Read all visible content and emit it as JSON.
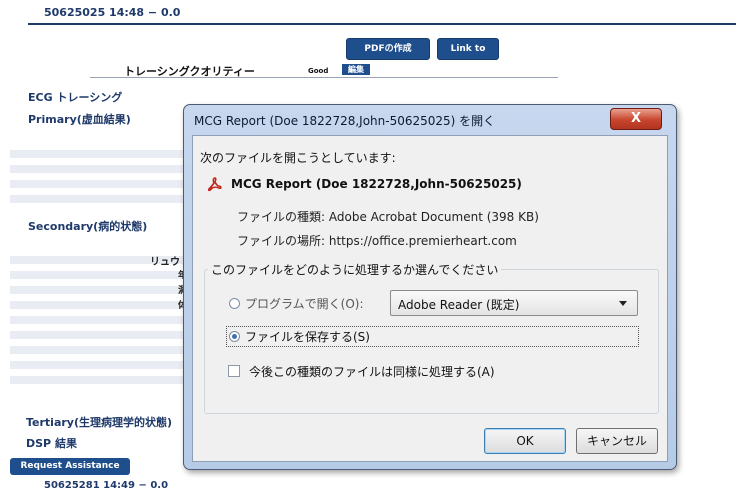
{
  "background": {
    "header_line": "50625025 14:48 − 0.0",
    "pdf_button": "PDFの作成",
    "link_button": "Link to",
    "tracing_quality_label": "トレーシングクオリティー",
    "tracing_quality_value": "Good",
    "edit_button": "編集",
    "ecg_label": "ECG トレーシング",
    "primary_label": "Primary(虚血結果)",
    "secondary_label": "Secondary(病的状態)",
    "row_label": "リュウ",
    "row_chars": [
      "年",
      "洞",
      "体"
    ],
    "tertiary_label": "Tertiary(生理病理学的状態)",
    "dsp_label": "DSP 結果",
    "request_button": "Request Assistance",
    "footer_line": "50625281 14:49 − 0.0"
  },
  "dialog": {
    "title": "MCG Report (Doe 1822728,John-50625025) を開く",
    "close_label": "X",
    "intro": "次のファイルを開こうとしています:",
    "file_icon": "pdf-icon",
    "file_name": "MCG Report (Doe 1822728,John-50625025)",
    "file_type_label": "ファイルの種類:",
    "file_type_value": "Adobe Acrobat Document (398 KB)",
    "file_location_label": "ファイルの場所:",
    "file_location_value": "https://office.premierheart.com",
    "group_label": "このファイルをどのように処理するか選んでください",
    "open_with_label": "プログラムで開く(O):",
    "open_with_app": "Adobe Reader (既定)",
    "save_label": "ファイルを保存する(S)",
    "save_selected": true,
    "remember_label": "今後この種類のファイルは同様に処理する(A)",
    "ok_label": "OK",
    "cancel_label": "キャンセル"
  },
  "colors": {
    "brand_blue": "#1e4f8c",
    "dialog_frame": "#c6d7ee",
    "close_red": "#c8452e"
  }
}
